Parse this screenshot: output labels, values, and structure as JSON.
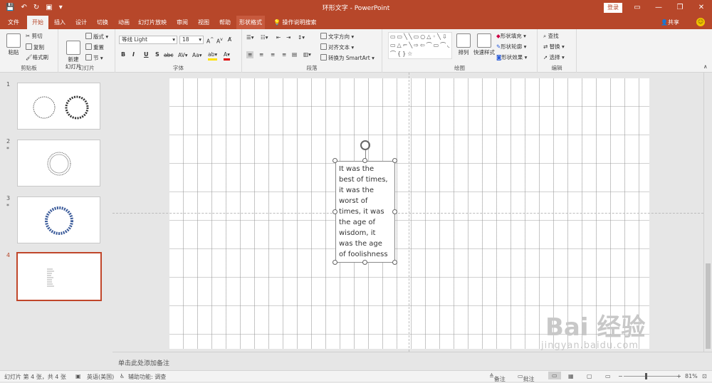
{
  "titlebar": {
    "title": "环形文字 - PowerPoint",
    "login": "登录",
    "qat_icons": [
      "save-icon",
      "undo-icon",
      "redo-icon",
      "present-icon",
      "customize-icon"
    ],
    "window_buttons": [
      "restore-ribbon-icon",
      "minimize-icon",
      "maximize-icon",
      "close-icon"
    ]
  },
  "tabs": {
    "items": [
      "文件",
      "开始",
      "插入",
      "设计",
      "切换",
      "动画",
      "幻灯片放映",
      "审阅",
      "视图",
      "帮助",
      "形状格式"
    ],
    "active": "开始",
    "search": "操作说明搜索",
    "share": "共享"
  },
  "ribbon": {
    "clipboard": {
      "label": "剪贴板",
      "paste": "粘贴",
      "cut": "剪切",
      "copy": "复制",
      "format_painter": "格式刷"
    },
    "slides": {
      "label": "幻灯片",
      "new_slide": "新建\n幻灯片",
      "layout": "版式",
      "reset": "重置",
      "section": "节"
    },
    "font": {
      "label": "字体",
      "font_name": "等线 Light",
      "font_size": "18"
    },
    "paragraph": {
      "label": "段落",
      "text_direction": "文字方向",
      "align_text": "对齐文本",
      "smartart": "转换为 SmartArt"
    },
    "drawing": {
      "label": "绘图",
      "arrange": "排列",
      "quick_styles": "快速样式",
      "fill": "形状填充",
      "outline": "形状轮廓",
      "effects": "形状效果"
    },
    "editing": {
      "label": "编辑",
      "find": "查找",
      "replace": "替换",
      "select": "选择"
    }
  },
  "thumbnails": [
    {
      "num": "1",
      "star": ""
    },
    {
      "num": "2",
      "star": "*"
    },
    {
      "num": "3",
      "star": "*"
    },
    {
      "num": "4",
      "star": ""
    }
  ],
  "textbox": {
    "lines": [
      "It was the",
      "best of times,",
      "it was the",
      "worst of",
      "times, it was",
      "the age of",
      "wisdom, it",
      "was the age",
      "of foolishness"
    ]
  },
  "notes": {
    "placeholder": "单击此处添加备注"
  },
  "status": {
    "slide_info": "幻灯片 第 4 张，共 4 张",
    "language": "英语(美国)",
    "accessibility": "辅助功能: 调查",
    "notes": "备注",
    "comments": "批注",
    "zoom": "81%"
  },
  "watermark": {
    "line1": "Bai 经验",
    "line2": "jingyan.baidu.com"
  }
}
